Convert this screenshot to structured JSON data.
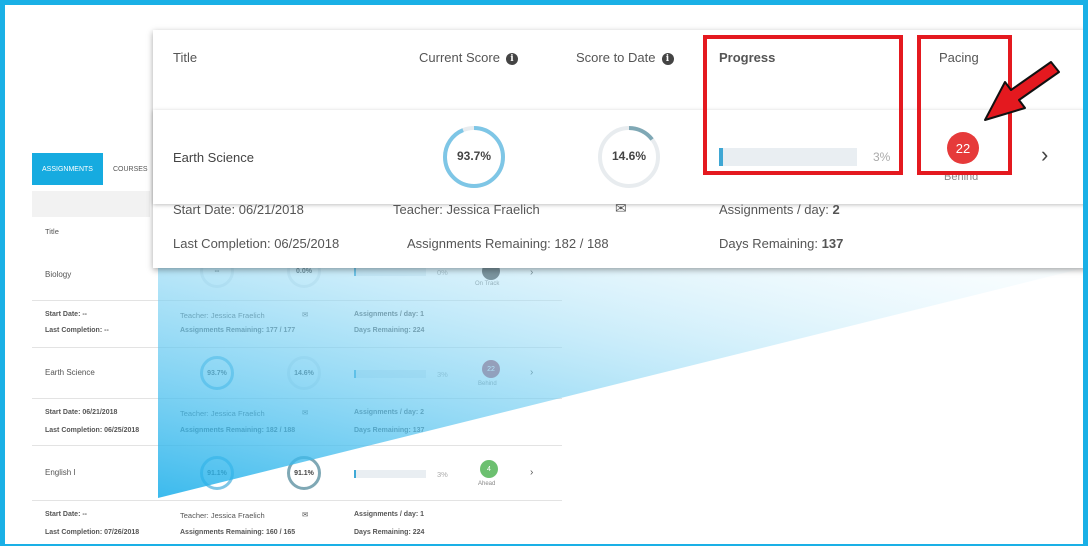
{
  "colors": {
    "accent": "#1ab0e6",
    "progress_fill": "#3fa7d4",
    "behind": "#e63a3a",
    "on_track": "#555555",
    "ahead": "#6cc070",
    "highlight": "#e4191f"
  },
  "background": {
    "tabs": [
      "ASSIGNMENTS",
      "COURSES"
    ],
    "title_header": "Title",
    "rows": [
      {
        "title": "Biology",
        "current": "--",
        "to_date": "0.0%",
        "progress": "0%",
        "pacing_status": "On Track",
        "start_date": "Start Date: --",
        "last_completion": "Last Completion: --",
        "teacher": "Teacher: Jessica Fraelich",
        "remaining": "Assignments Remaining: 177 / 177",
        "per_day": "Assignments / day: 1",
        "days_remaining": "Days Remaining: 224"
      },
      {
        "title": "Earth Science",
        "current": "93.7%",
        "to_date": "14.6%",
        "progress": "3%",
        "pacing_value": "22",
        "pacing_status": "Behind",
        "start_date": "Start Date: 06/21/2018",
        "last_completion": "Last Completion: 06/25/2018",
        "teacher": "Teacher: Jessica Fraelich",
        "remaining": "Assignments Remaining: 182 / 188",
        "per_day": "Assignments / day: 2",
        "days_remaining": "Days Remaining: 137"
      },
      {
        "title": "English I",
        "current": "91.1%",
        "to_date": "91.1%",
        "progress": "3%",
        "pacing_value": "4",
        "pacing_status": "Ahead",
        "start_date": "Start Date: --",
        "last_completion": "Last Completion: 07/26/2018",
        "teacher": "Teacher: Jessica Fraelich",
        "remaining": "Assignments Remaining: 160 / 165",
        "per_day": "Assignments / day: 1",
        "days_remaining": "Days Remaining: 224"
      }
    ]
  },
  "zoom": {
    "headers": {
      "title": "Title",
      "current_score": "Current Score",
      "score_to_date": "Score to Date",
      "progress": "Progress",
      "pacing": "Pacing"
    },
    "info_icon": "info-icon",
    "course": "Earth Science",
    "current_score": "93.7%",
    "current_score_fraction": 0.937,
    "score_to_date": "14.6%",
    "score_to_date_fraction": 0.146,
    "progress_pct": "3%",
    "progress_fraction": 0.03,
    "pacing_value": "22",
    "pacing_status": "Behind",
    "start_date_label": "Start Date:",
    "start_date": "06/21/2018",
    "last_completion_label": "Last Completion:",
    "last_completion": "06/25/2018",
    "teacher_label": "Teacher:",
    "teacher": "Jessica Fraelich",
    "assignments_remaining_label": "Assignments Remaining:",
    "assignments_remaining": "182 / 188",
    "assignments_per_day_label": "Assignments / day:",
    "assignments_per_day": "2",
    "days_remaining_label": "Days Remaining:",
    "days_remaining": "137"
  }
}
